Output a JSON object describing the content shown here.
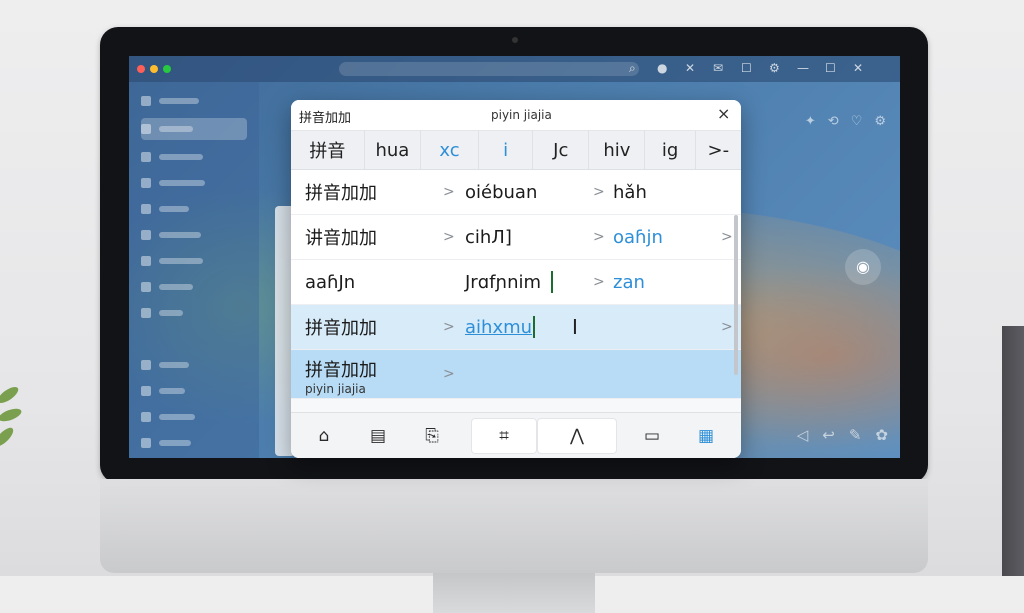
{
  "popup": {
    "title": "拼音加加",
    "subtitle": "piyin jiajia",
    "close_glyph": "×"
  },
  "tabs": [
    {
      "label": "拼音",
      "accent": false
    },
    {
      "label": "hua",
      "accent": false
    },
    {
      "label": "xc",
      "accent": true
    },
    {
      "label": "i",
      "accent": true
    },
    {
      "label": "Jc",
      "accent": false
    },
    {
      "label": "hiv",
      "accent": false
    },
    {
      "label": "ig",
      "accent": false
    },
    {
      "label": ">-",
      "accent": false
    }
  ],
  "rows": [
    {
      "c1": "拼音加加",
      "c2": "oiébuan",
      "c3": "hǎh"
    },
    {
      "c1": "讲音加加",
      "c2": "cihЛ]",
      "c3": "oaɦjn"
    },
    {
      "c1": "aaɦJn",
      "c2": "Jrɑfɲnim",
      "c3": "zan"
    },
    {
      "c1": "拼音加加",
      "c2": "aihxmu",
      "c3": ""
    },
    {
      "c1": "拼音加加",
      "c1_sub": "piyin jiajia",
      "c2": "",
      "c3": ""
    }
  ],
  "toolbar": [
    {
      "name": "home-icon",
      "glyph": "⌂"
    },
    {
      "name": "notes-icon",
      "glyph": "▤"
    },
    {
      "name": "clipboard-icon",
      "glyph": "⎘"
    },
    {
      "name": "crop-icon",
      "glyph": "⌗"
    },
    {
      "name": "handwrite-icon",
      "glyph": "⋀"
    },
    {
      "name": "message-icon",
      "glyph": "▭"
    },
    {
      "name": "qr-icon",
      "glyph": "▦"
    }
  ],
  "colors": {
    "accent": "#2d8fd8",
    "selected_row": "#d8ebf9",
    "selected_row_strong": "#b8dcf5"
  }
}
